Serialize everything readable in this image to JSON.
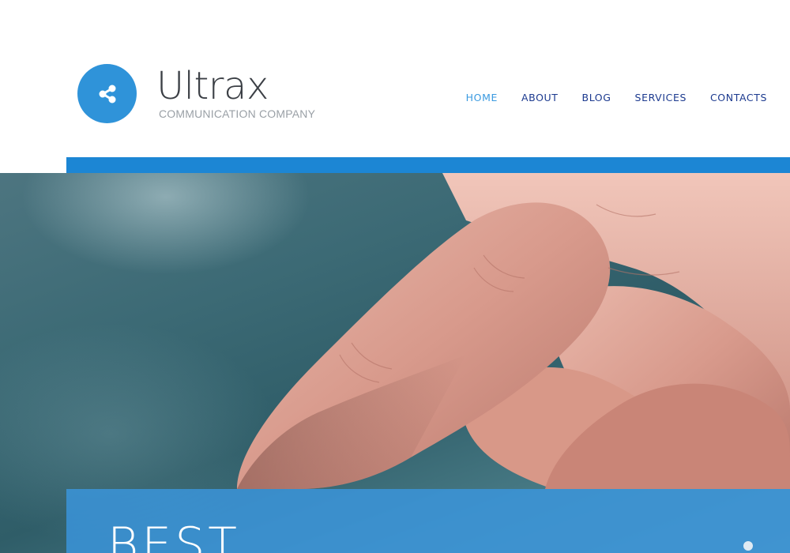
{
  "header": {
    "brand": {
      "name": "Ultrax",
      "tagline": "COMMUNICATION COMPANY",
      "icon": "share-icon"
    },
    "nav": [
      {
        "label": "HOME",
        "active": true
      },
      {
        "label": "ABOUT",
        "active": false
      },
      {
        "label": "BLOG",
        "active": false
      },
      {
        "label": "SERVICES",
        "active": false
      },
      {
        "label": "CONTACTS",
        "active": false
      }
    ]
  },
  "hero": {
    "image": "finger-touch-image",
    "caption": "BEST",
    "slider_indicator": "slider-dot"
  },
  "colors": {
    "accent": "#2f93d9",
    "band": "#1c86d4",
    "nav_text": "#1c3a8f",
    "nav_active": "#3a9ae0"
  }
}
